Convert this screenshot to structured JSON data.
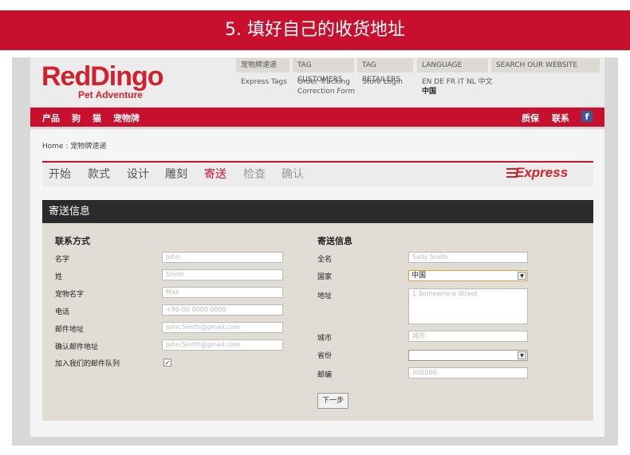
{
  "banner": {
    "title": "5. 填好自己的收货地址"
  },
  "brand": {
    "logo_main": "RedDingo",
    "logo_sub": "Pet Adventure",
    "accent": "#c8102e",
    "panel_bg": "#e2ddd4",
    "header_bg": "#2b2b2b"
  },
  "top_nav": {
    "express_tags": "宠物牌速递",
    "express_tags_sub": "Express Tags",
    "tag_customers": "TAG CUSTOMERS",
    "tag_customers_sub1": "Order Tracking",
    "tag_customers_sub2": "Correction Form",
    "tag_retailers": "TAG RETAILERS",
    "tag_retailers_sub": "Store Login",
    "language": "LANGUAGE",
    "language_options": "EN DE FR IT NL 中文",
    "language_current": "中国",
    "search": "SEARCH OUR WEBSITE"
  },
  "main_nav": {
    "products": "产品",
    "dog": "狗",
    "cat": "猫",
    "pet_tags": "宠物牌",
    "warranty": "质保",
    "contact": "联系",
    "facebook": "f"
  },
  "breadcrumb": "Home : 宠物牌速递",
  "steps": [
    {
      "label": "开始"
    },
    {
      "label": "款式"
    },
    {
      "label": "设计"
    },
    {
      "label": "雕刻"
    },
    {
      "label": "寄送"
    },
    {
      "label": "检查"
    },
    {
      "label": "确认"
    }
  ],
  "active_step": "寄送",
  "express_logo": "Express",
  "panel_title": "寄送信息",
  "contact": {
    "heading": "联系方式",
    "first_name_label": "名字",
    "first_name_ph": "John",
    "last_name_label": "姓",
    "last_name_ph": "Smith",
    "pet_name_label": "宠物名字",
    "pet_name_ph": "Max",
    "phone_label": "电话",
    "phone_ph": "+86-00 0000 0000",
    "email_label": "邮件地址",
    "email_ph": "John.Smith@gmail.com",
    "email_confirm_label": "确认邮件地址",
    "email_confirm_ph": "John.Smith@gmail.com",
    "mailing_list_label": "加入我们的邮件队列",
    "mailing_list_checked": "✓"
  },
  "shipping": {
    "heading": "寄送信息",
    "full_name_label": "全名",
    "full_name_ph": "Sally Smith",
    "country_label": "国家",
    "country_value": "中国",
    "address_label": "地址",
    "address_ph": "1 Somewhere Street",
    "city_label": "城市",
    "city_ph": "城市",
    "province_label": "省份",
    "province_value": "",
    "postcode_label": "邮编",
    "postcode_ph": "000000"
  },
  "next_button": "下一步"
}
